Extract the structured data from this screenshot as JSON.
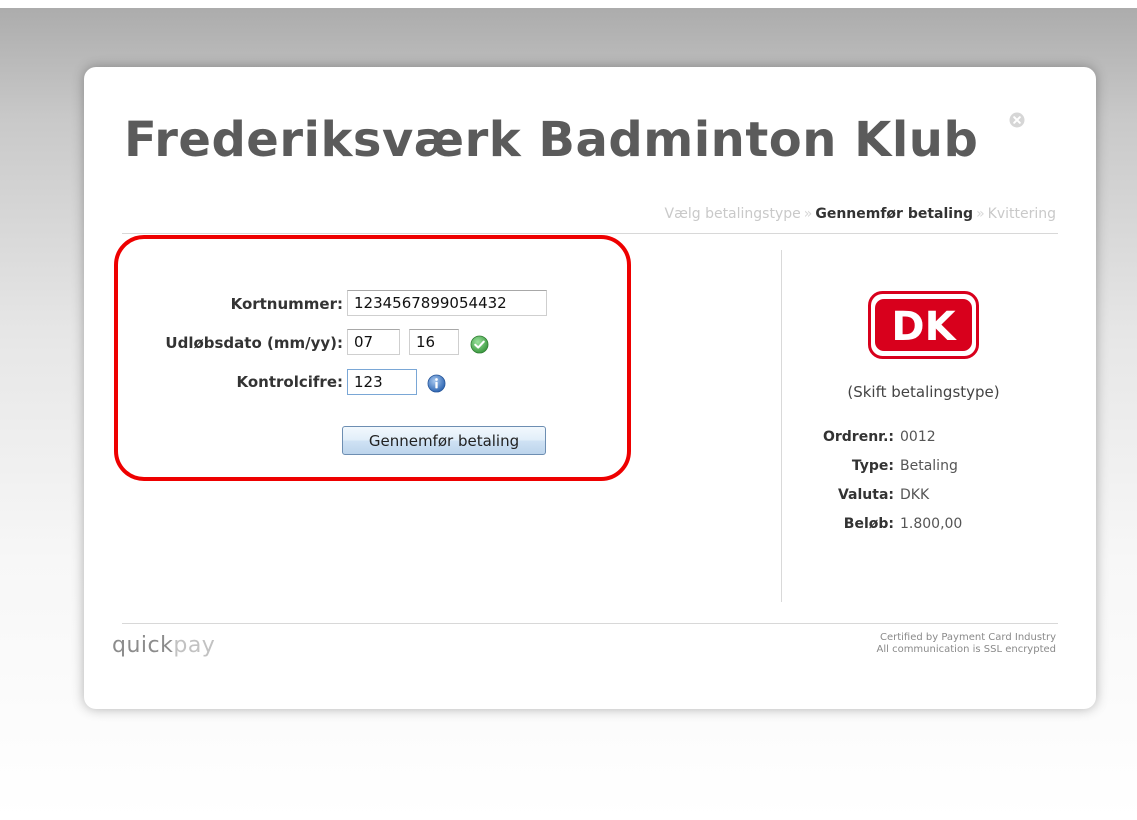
{
  "header": {
    "title": "Frederiksværk Badminton Klub"
  },
  "steps": {
    "step1": "Vælg betalingstype",
    "step2": "Gennemfør betaling",
    "step3": "Kvittering",
    "separator": "»"
  },
  "form": {
    "card_number_label": "Kortnummer:",
    "card_number_value": "1234567899054432",
    "expiry_label": "Udløbsdato (mm/yy):",
    "expiry_month_value": "07",
    "expiry_year_value": "16",
    "cvc_label": "Kontrolcifre:",
    "cvc_value": "123",
    "submit_label": "Gennemfør betaling"
  },
  "payment_info": {
    "switch_link": "(Skift betalingstype)",
    "order_label": "Ordrenr.:",
    "order_value": "0012",
    "type_label": "Type:",
    "type_value": "Betaling",
    "currency_label": "Valuta:",
    "currency_value": "DKK",
    "amount_label": "Beløb:",
    "amount_value": "1.800,00",
    "card_logo": "DK"
  },
  "footer": {
    "brand_dark": "quick",
    "brand_light": "pay",
    "cert_line1": "Certified by Payment Card Industry",
    "cert_line2": "All communication is SSL encrypted"
  },
  "colors": {
    "highlight": "#ee0000",
    "dk_red": "#d8001c",
    "ok_green": "#4caf50",
    "info_blue": "#3d77c2"
  },
  "icons": {
    "close": "close-icon",
    "valid": "check-circle-icon",
    "info": "info-icon"
  }
}
